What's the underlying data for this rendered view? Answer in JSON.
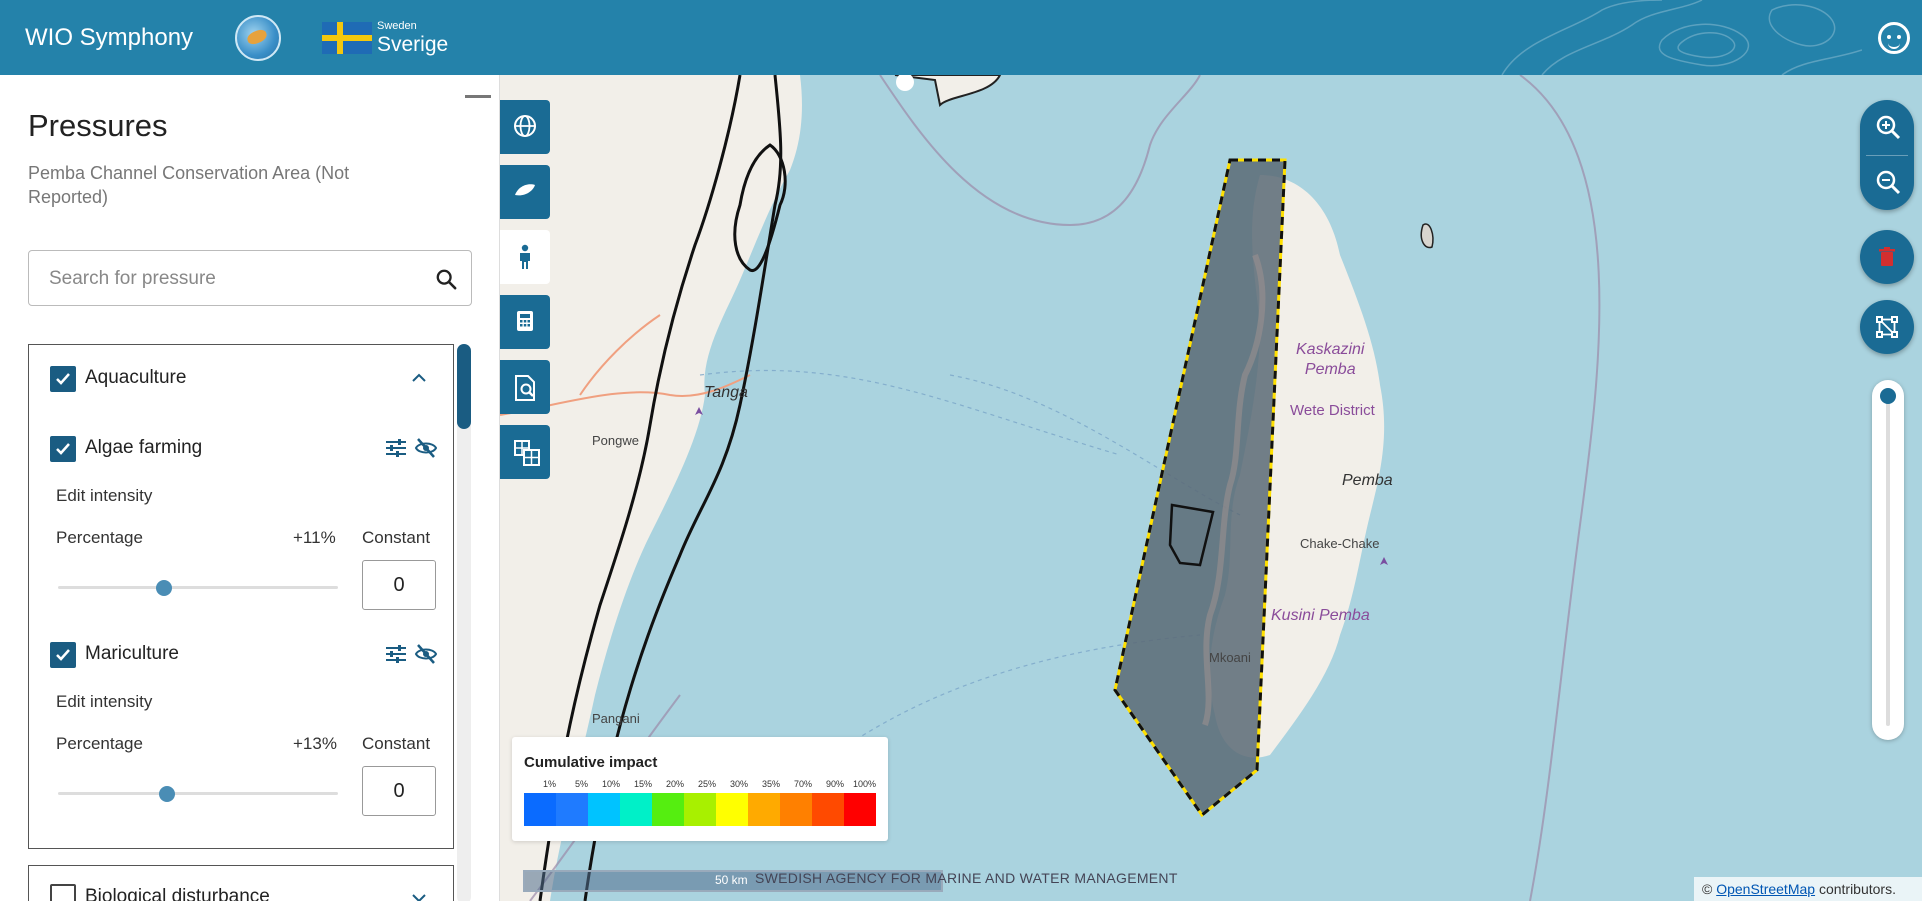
{
  "header": {
    "app_title": "WIO Symphony",
    "partner_small": "Sweden",
    "partner_big": "Sverige",
    "color": "#2482aa"
  },
  "panel": {
    "title": "Pressures",
    "subtitle": "Pemba Channel Conservation Area (Not Reported)",
    "search_placeholder": "Search for pressure",
    "groups": [
      {
        "label": "Aquaculture",
        "checked": true,
        "expanded": true,
        "items": [
          {
            "label": "Algae farming",
            "checked": true,
            "edit_intensity_label": "Edit intensity",
            "percentage_label": "Percentage",
            "percentage_value": "+11%",
            "percentage_fraction": 0.38,
            "constant_label": "Constant",
            "constant_value": "0"
          },
          {
            "label": "Mariculture",
            "checked": true,
            "edit_intensity_label": "Edit intensity",
            "percentage_label": "Percentage",
            "percentage_value": "+13%",
            "percentage_fraction": 0.39,
            "constant_label": "Constant",
            "constant_value": "0"
          }
        ]
      },
      {
        "label": "Biological disturbance",
        "checked": false,
        "expanded": false
      }
    ]
  },
  "legend": {
    "title": "Cumulative impact",
    "ticks": [
      "1%",
      "5%",
      "10%",
      "15%",
      "20%",
      "25%",
      "30%",
      "35%",
      "70%",
      "90%",
      "100%"
    ],
    "colors": [
      "#0a6bff",
      "#1f7bff",
      "#00c3ff",
      "#00f0c8",
      "#55ee10",
      "#a8f000",
      "#ffff00",
      "#ffaa00",
      "#ff8000",
      "#ff4a00",
      "#ff0000"
    ]
  },
  "map": {
    "labels": {
      "tanga": "Tanga",
      "pongwe": "Pongwe",
      "pangani": "Pangani",
      "kaskazini": "Kaskazini\nPemba",
      "wete": "Wete District",
      "pemba": "Pemba",
      "chake": "Chake-Chake",
      "kusini": "Kusini Pemba",
      "mkoani": "Mkoani"
    },
    "scale": "50 km",
    "agency": "SWEDISH AGENCY FOR MARINE AND WATER MANAGEMENT",
    "attribution_prefix": "© ",
    "attribution_link": "OpenStreetMap",
    "attribution_suffix": " contributors.",
    "colors": {
      "water": "#aad3df",
      "land": "#f2efe9",
      "selection": "#5a6a75"
    }
  }
}
